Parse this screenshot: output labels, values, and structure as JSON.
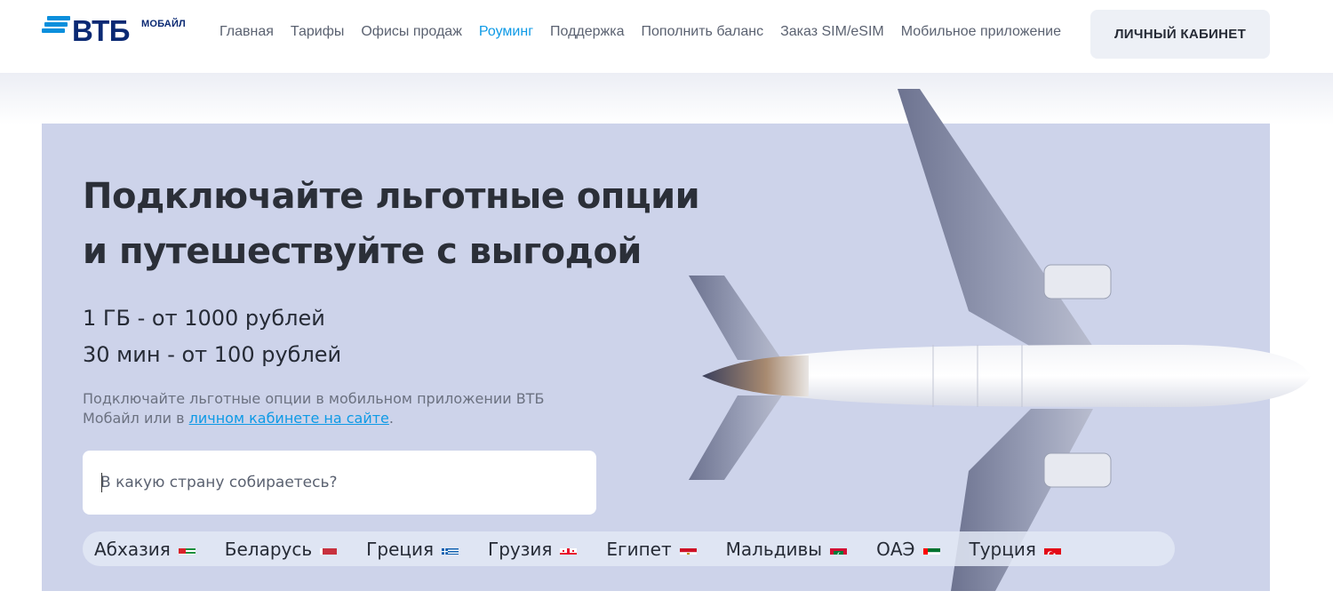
{
  "brand": {
    "name": "ВТБ",
    "sub": "МОБАЙЛ"
  },
  "nav": [
    {
      "label": "Главная",
      "active": false
    },
    {
      "label": "Тарифы",
      "active": false
    },
    {
      "label": "Офисы продаж",
      "active": false
    },
    {
      "label": "Роуминг",
      "active": true
    },
    {
      "label": "Поддержка",
      "active": false
    },
    {
      "label": "Пополнить баланс",
      "active": false
    },
    {
      "label": "Заказ SIM/eSIM",
      "active": false
    },
    {
      "label": "Мобильное приложение",
      "active": false
    }
  ],
  "cabinet_button": "ЛИЧНЫЙ КАБИНЕТ",
  "hero": {
    "title_line1": "Подключайте льготные опции",
    "title_line2": "и путешествуйте с выгодой",
    "price_data": "1 ГБ - от 1000 рублей",
    "price_minutes": "30 мин - от 100 рублей",
    "note_text": "Подключайте льготные опции в мобильном приложении ВТБ Мобайл или в ",
    "note_link": "личном кабинете на сайте",
    "note_end": "."
  },
  "search": {
    "placeholder": "В какую страну собираетесь?"
  },
  "countries": [
    {
      "name": "Абхазия",
      "flag": "abkhazia-flag-icon"
    },
    {
      "name": "Беларусь",
      "flag": "belarus-flag-icon"
    },
    {
      "name": "Греция",
      "flag": "greece-flag-icon"
    },
    {
      "name": "Грузия",
      "flag": "georgia-flag-icon"
    },
    {
      "name": "Египет",
      "flag": "egypt-flag-icon"
    },
    {
      "name": "Мальдивы",
      "flag": "maldives-flag-icon"
    },
    {
      "name": "ОАЭ",
      "flag": "uae-flag-icon"
    },
    {
      "name": "Турция",
      "flag": "turkey-flag-icon"
    }
  ],
  "colors": {
    "accent": "#0e9ae6",
    "brand_dark": "#0a2973",
    "hero_bg": "#cdd3ea"
  }
}
